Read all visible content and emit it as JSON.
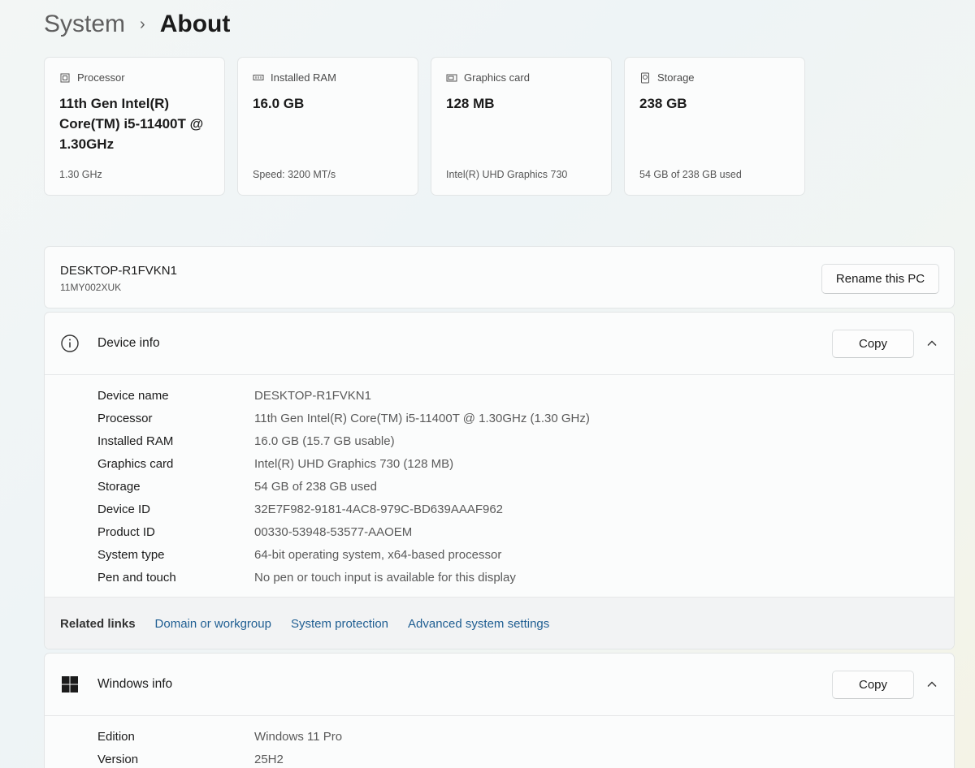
{
  "breadcrumb": {
    "parent": "System",
    "separator": "›",
    "current": "About"
  },
  "cards": [
    {
      "icon": "cpu-icon",
      "label": "Processor",
      "value": "11th Gen Intel(R) Core(TM) i5-11400T @ 1.30GHz",
      "sub": "1.30 GHz"
    },
    {
      "icon": "ram-icon",
      "label": "Installed RAM",
      "value": "16.0 GB",
      "sub": "Speed: 3200 MT/s"
    },
    {
      "icon": "gpu-icon",
      "label": "Graphics card",
      "value": "128 MB",
      "sub": "Intel(R) UHD Graphics 730"
    },
    {
      "icon": "storage-icon",
      "label": "Storage",
      "value": "238 GB",
      "sub": "54 GB of 238 GB used"
    }
  ],
  "pc": {
    "name": "DESKTOP-R1FVKN1",
    "model": "11MY002XUK",
    "rename_label": "Rename this PC"
  },
  "device_info": {
    "title": "Device info",
    "icon": "info-icon",
    "copy_label": "Copy",
    "rows": [
      {
        "key": "Device name",
        "value": "DESKTOP-R1FVKN1"
      },
      {
        "key": "Processor",
        "value": "11th Gen Intel(R) Core(TM) i5-11400T @ 1.30GHz (1.30 GHz)"
      },
      {
        "key": "Installed RAM",
        "value": "16.0 GB (15.7 GB usable)"
      },
      {
        "key": "Graphics card",
        "value": "Intel(R) UHD Graphics 730 (128 MB)"
      },
      {
        "key": "Storage",
        "value": "54 GB of 238 GB used"
      },
      {
        "key": "Device ID",
        "value": "32E7F982-9181-4AC8-979C-BD639AAAF962"
      },
      {
        "key": "Product ID",
        "value": "00330-53948-53577-AAOEM"
      },
      {
        "key": "System type",
        "value": "64-bit operating system, x64-based processor"
      },
      {
        "key": "Pen and touch",
        "value": "No pen or touch input is available for this display"
      }
    ],
    "related": {
      "label": "Related links",
      "links": [
        "Domain or workgroup",
        "System protection",
        "Advanced system settings"
      ]
    }
  },
  "windows_info": {
    "title": "Windows info",
    "icon": "windows-logo-icon",
    "copy_label": "Copy",
    "rows": [
      {
        "key": "Edition",
        "value": "Windows 11 Pro"
      },
      {
        "key": "Version",
        "value": "25H2"
      }
    ]
  }
}
